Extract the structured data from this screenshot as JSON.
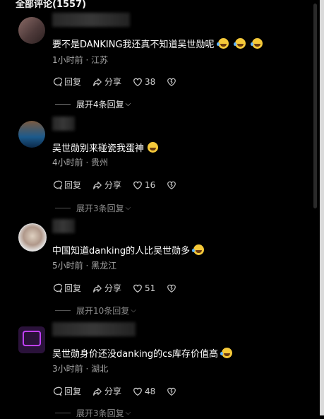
{
  "header": {
    "title": "全部评论(1557)"
  },
  "labels": {
    "reply": "回复",
    "share": "分享"
  },
  "comments": [
    {
      "text": "要不是DANKING我还真不知道吴世勋呢",
      "emojis": [
        "rolling-laugh-emoji",
        "rolling-laugh-emoji",
        "rolling-laugh-emoji"
      ],
      "time": "1小时前 · 江苏",
      "likes": "38",
      "expand": "展开4条回复"
    },
    {
      "text": "吴世勋别来碰瓷我蛋神",
      "emojis": [
        "smirk-emoji"
      ],
      "time": "4小时前 · 贵州",
      "likes": "16",
      "expand": "展开3条回复"
    },
    {
      "text": "中国知道danking的人比吴世勋多",
      "emojis": [
        "rolling-laugh-emoji"
      ],
      "time": "5小时前 · 黑龙江",
      "likes": "51",
      "expand": "展开10条回复"
    },
    {
      "text": "吴世勋身价还没danking的cs库存价值高",
      "emojis": [
        "rolling-laugh-emoji"
      ],
      "time": "3小时前 · 湖北",
      "likes": "48",
      "expand": "展开3条回复"
    }
  ]
}
